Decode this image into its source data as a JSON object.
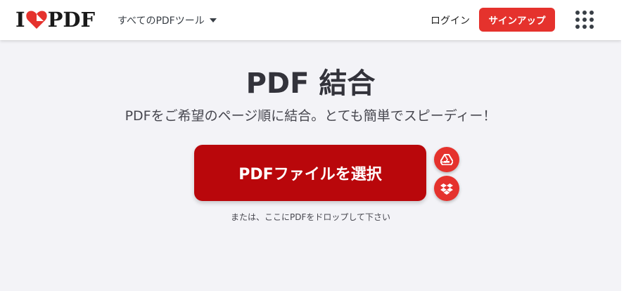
{
  "header": {
    "logo": {
      "left": "I",
      "right": "PDF"
    },
    "tools_menu_label": "すべてのPDFツール",
    "login_label": "ログイン",
    "signup_label": "サインアップ",
    "apps_icon": "grid-icon"
  },
  "main": {
    "title": "PDF 結合",
    "subtitle": "PDFをご希望のページ順に結合。とても簡単でスピーディー！",
    "select_button_label": "PDFファイルを選択",
    "cloud_buttons": [
      {
        "icon": "google-drive-icon"
      },
      {
        "icon": "dropbox-icon"
      }
    ],
    "drop_hint": "または、ここにPDFをドロップして下さい"
  },
  "colors": {
    "brand_red": "#e5322d",
    "button_red": "#b9070b",
    "page_bg": "#f3f3f7",
    "text_dark": "#33333b"
  }
}
